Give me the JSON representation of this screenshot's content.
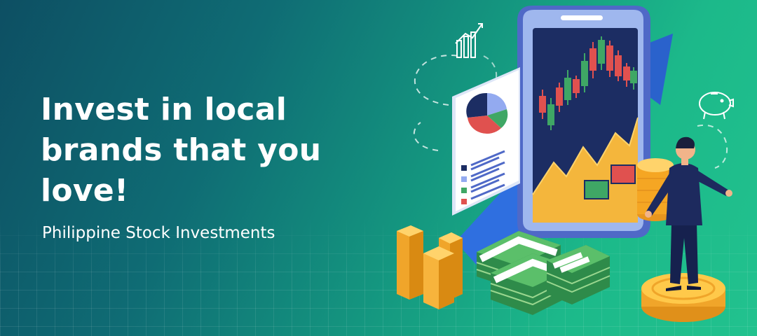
{
  "headline": {
    "line1": "Invest in local",
    "line2": "brands that you",
    "line3": "love!"
  },
  "subheadline": "Philippine Stock Investments",
  "colors": {
    "background_dark": "#0d4f63",
    "background_light": "#22c28e",
    "phone_frame": "#5b79d8",
    "phone_screen": "#1c2d63",
    "candle_red": "#e0514f",
    "candle_green": "#3fa765",
    "area_chart": "#f4b63c",
    "arrow_blue": "#2f6fe0",
    "coin_gold": "#f5a623",
    "cash_green": "#2e8b4a",
    "figure_suit": "#1d2a5e"
  },
  "icons": [
    "line-chart-icon",
    "piggy-bank-icon",
    "pie-chart-icon"
  ]
}
